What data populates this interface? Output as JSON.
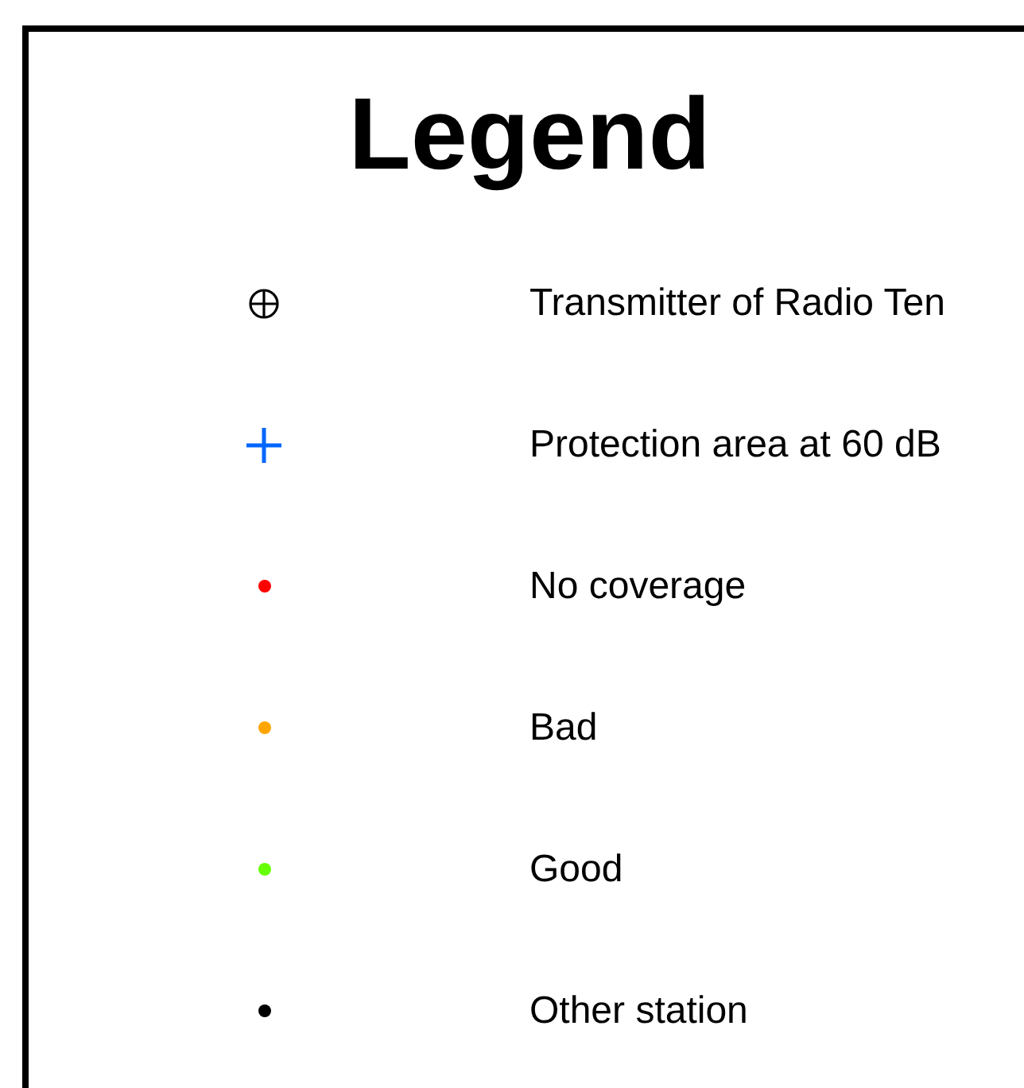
{
  "title": "Legend",
  "items": [
    {
      "kind": "crosshair",
      "label": "Transmitter of Radio Ten"
    },
    {
      "kind": "plus",
      "label": "Protection area at 60 dB"
    },
    {
      "kind": "dot",
      "color": "#ff0000",
      "label": "No coverage"
    },
    {
      "kind": "dot",
      "color": "#ffa500",
      "label": "Bad"
    },
    {
      "kind": "dot",
      "color": "#66ff00",
      "label": "Good"
    },
    {
      "kind": "dot",
      "color": "#000000",
      "label": "Other station"
    }
  ]
}
